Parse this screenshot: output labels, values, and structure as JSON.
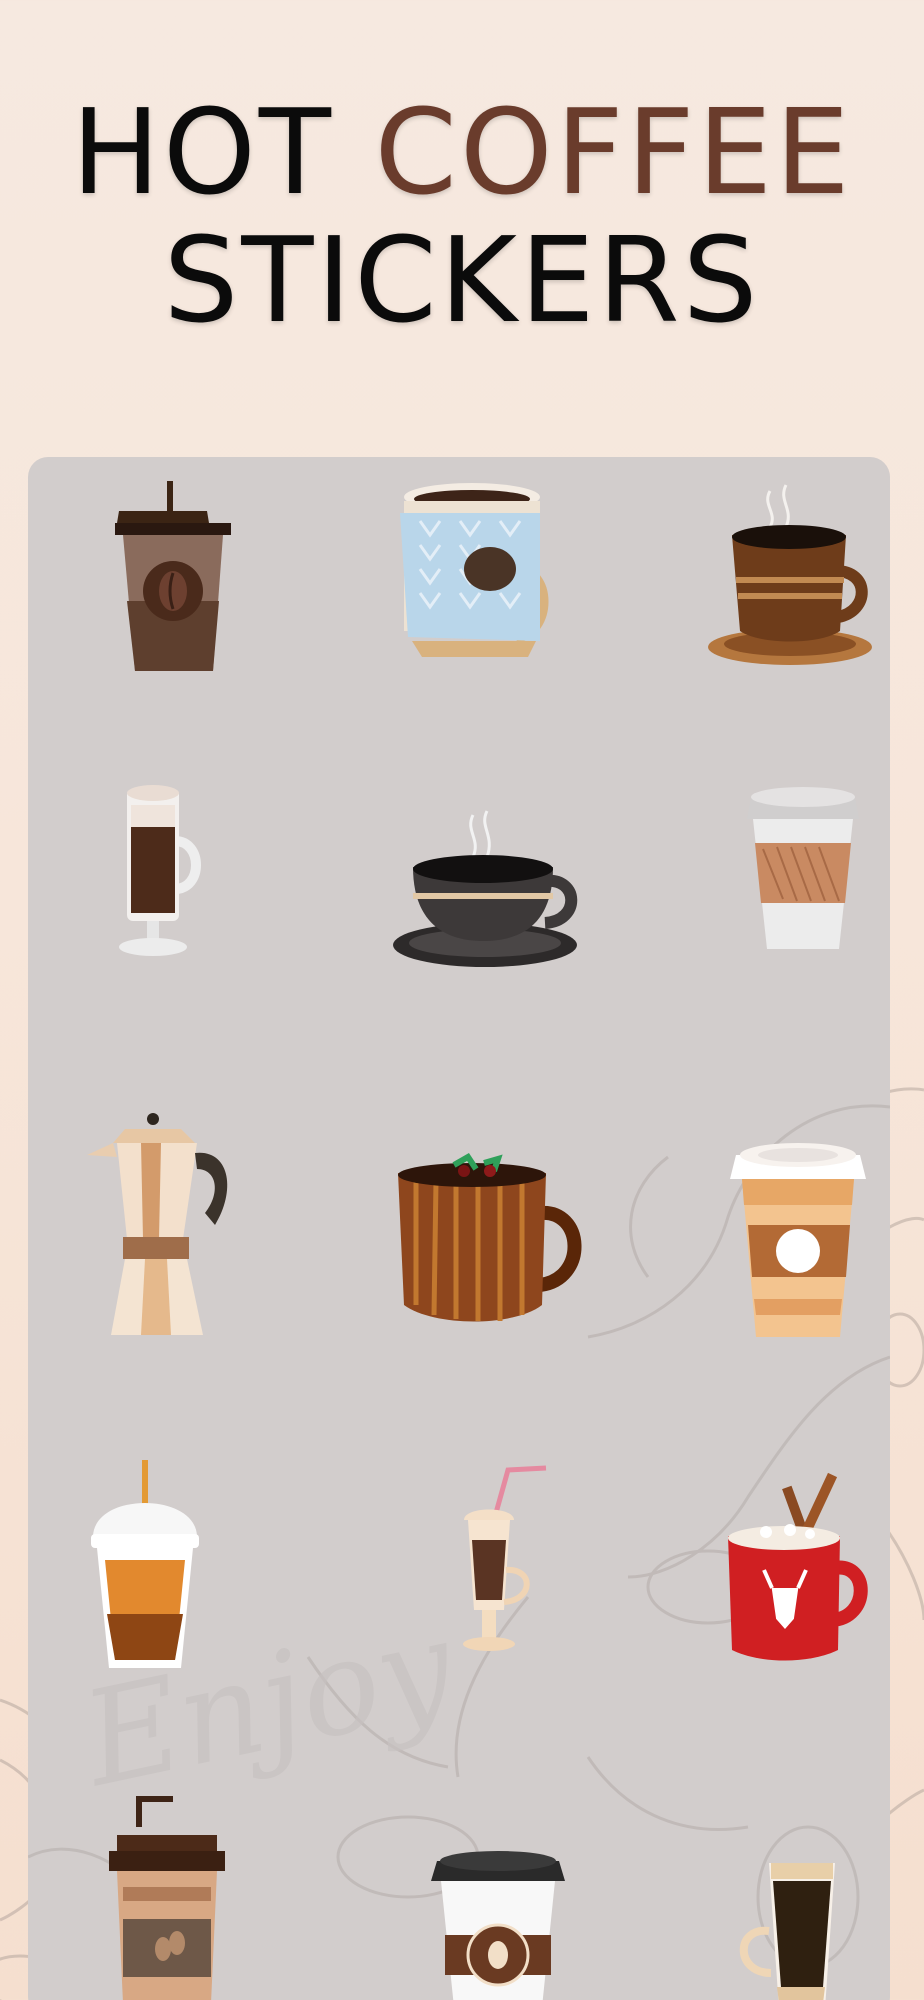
{
  "header": {
    "title_word_1": "HOT",
    "title_word_2": "COFFEE",
    "title_word_3": "STICKERS"
  },
  "background": {
    "watermark_text": "Enjoy"
  },
  "colors": {
    "page_background": "#f6e9e0",
    "panel_background": "#d2cdcc",
    "title_text": "#0b0b0b",
    "title_accent": "#6a3c2c"
  },
  "stickers": [
    {
      "name": "takeaway-cup-bean-logo-sticker"
    },
    {
      "name": "knitted-sweater-mug-sticker"
    },
    {
      "name": "striped-cup-saucer-sticker"
    },
    {
      "name": "irish-coffee-glass-sticker"
    },
    {
      "name": "dark-cup-saucer-sticker"
    },
    {
      "name": "paper-cup-sleeve-sticker"
    },
    {
      "name": "moka-pot-sticker"
    },
    {
      "name": "wooden-mug-sticker"
    },
    {
      "name": "takeaway-latte-cup-sticker"
    },
    {
      "name": "iced-coffee-dome-cup-sticker"
    },
    {
      "name": "frappe-glass-straw-sticker"
    },
    {
      "name": "red-reindeer-mug-sticker"
    },
    {
      "name": "takeaway-cup-straw-bean-sticker"
    },
    {
      "name": "coffee-to-go-cup-sticker"
    },
    {
      "name": "layered-latte-glass-sticker"
    }
  ]
}
